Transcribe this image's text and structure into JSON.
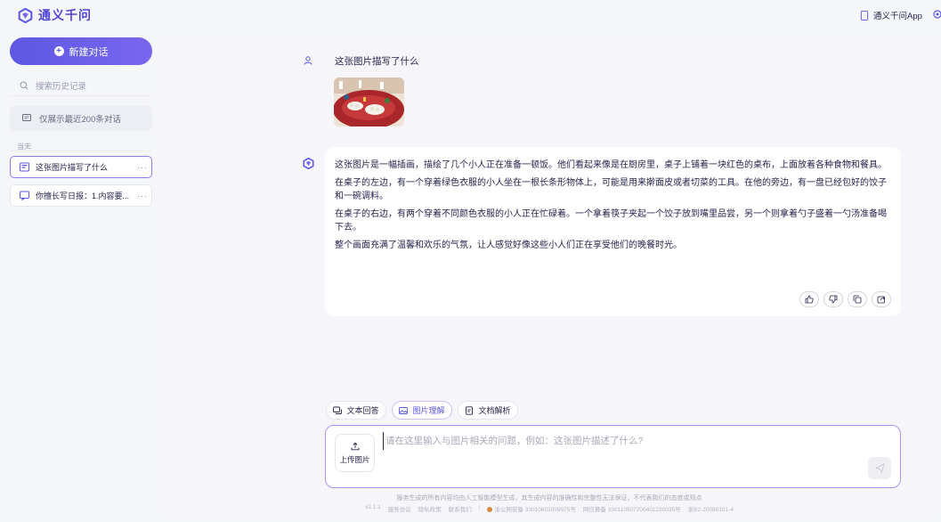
{
  "header": {
    "app_name": "通义千问",
    "app_link_label": "通义千问App"
  },
  "sidebar": {
    "new_chat_label": "新建对话",
    "search_placeholder": "搜索历史记录",
    "notice": "仅展示最近200条对话",
    "group_label": "当天",
    "conversations": [
      {
        "title": "这张图片描写了什么",
        "more": "···",
        "active": true
      },
      {
        "title": "你擅长写日报：1.内容要...",
        "more": "···",
        "active": false
      }
    ]
  },
  "chat": {
    "user_message": "这张图片描写了什么",
    "answer_paragraphs": [
      "这张图片是一幅插画，描绘了几个小人正在准备一顿饭。他们看起来像是在厨房里，桌子上铺着一块红色的桌布，上面放着各种食物和餐具。",
      "在桌子的左边，有一个穿着绿色衣服的小人坐在一根长条形物体上，可能是用来擀面皮或者切菜的工具。在他的旁边，有一盘已经包好的饺子和一碗调料。",
      "在桌子的右边，有两个穿着不同颜色衣服的小人正在忙碌着。一个拿着筷子夹起一个饺子放到嘴里品尝，另一个则拿着勺子盛着一勺汤准备喝下去。",
      "整个画面充满了温馨和欢乐的气氛，让人感觉好像这些小人们正在享受他们的晚餐时光。"
    ],
    "action_icons": [
      "thumbs-up-icon",
      "thumbs-down-icon",
      "copy-icon",
      "share-icon"
    ]
  },
  "modes": [
    {
      "label": "文本回答",
      "icon": "chat-icon",
      "active": false
    },
    {
      "label": "图片理解",
      "icon": "image-icon",
      "active": true
    },
    {
      "label": "文档解析",
      "icon": "document-icon",
      "active": false
    }
  ],
  "composer": {
    "upload_label": "上传图片",
    "placeholder": "请在这里输入与图片相关的问题，例如：这张图片描述了什么?"
  },
  "footer": {
    "disclaimer": "服务生成的所有内容均由人工智能模型生成，其生成内容的准确性和完整性无法保证，不代表我们的态度或观点",
    "version": "v2.1.1",
    "links": [
      "服务协议",
      "隐私政策",
      "联系我们"
    ],
    "police_record": "浙公网安备 33010602009975号",
    "icp_record": "网信算备 330110507206401230035号",
    "icp2": "浙B2-20080101-4"
  },
  "colors": {
    "accent": "#5d58e3",
    "accent_border": "#a895f3",
    "background": "#f5f6f9"
  }
}
